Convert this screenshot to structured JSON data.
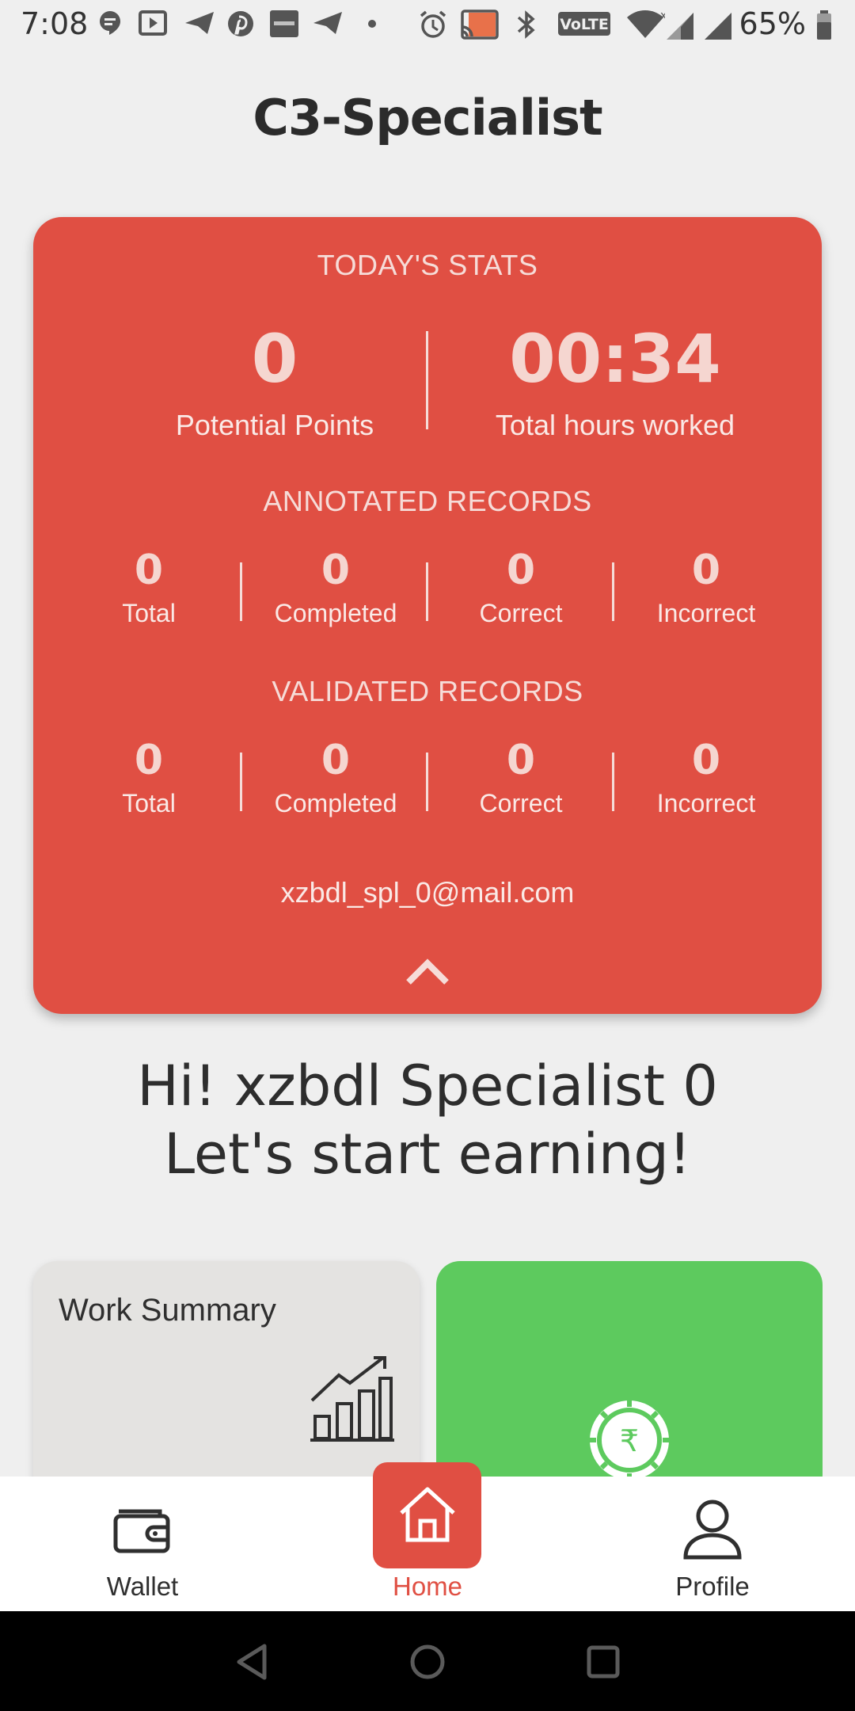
{
  "status_bar": {
    "time": "7:08",
    "battery": "65%"
  },
  "app": {
    "title": "C3-Specialist"
  },
  "stats": {
    "section_title": "TODAY'S STATS",
    "potential_points": {
      "value": "0",
      "label": "Potential Points"
    },
    "hours_worked": {
      "value": "00:34",
      "label": "Total hours worked"
    },
    "annotated": {
      "title": "ANNOTATED RECORDS",
      "cells": [
        {
          "value": "0",
          "label": "Total"
        },
        {
          "value": "0",
          "label": "Completed"
        },
        {
          "value": "0",
          "label": "Correct"
        },
        {
          "value": "0",
          "label": "Incorrect"
        }
      ]
    },
    "validated": {
      "title": "VALIDATED RECORDS",
      "cells": [
        {
          "value": "0",
          "label": "Total"
        },
        {
          "value": "0",
          "label": "Completed"
        },
        {
          "value": "0",
          "label": "Correct"
        },
        {
          "value": "0",
          "label": "Incorrect"
        }
      ]
    },
    "email": "xzbdl_spl_0@mail.com"
  },
  "greeting": {
    "line1": "Hi! xzbdl Specialist 0",
    "line2": "Let's start earning!"
  },
  "tiles": {
    "work_summary": "Work Summary",
    "earnings_icon": "rupee-coin-icon"
  },
  "nav": {
    "wallet": "Wallet",
    "home": "Home",
    "profile": "Profile"
  },
  "colors": {
    "accent": "#e04f43",
    "earnings": "#5dca5e",
    "background": "#efefef"
  }
}
